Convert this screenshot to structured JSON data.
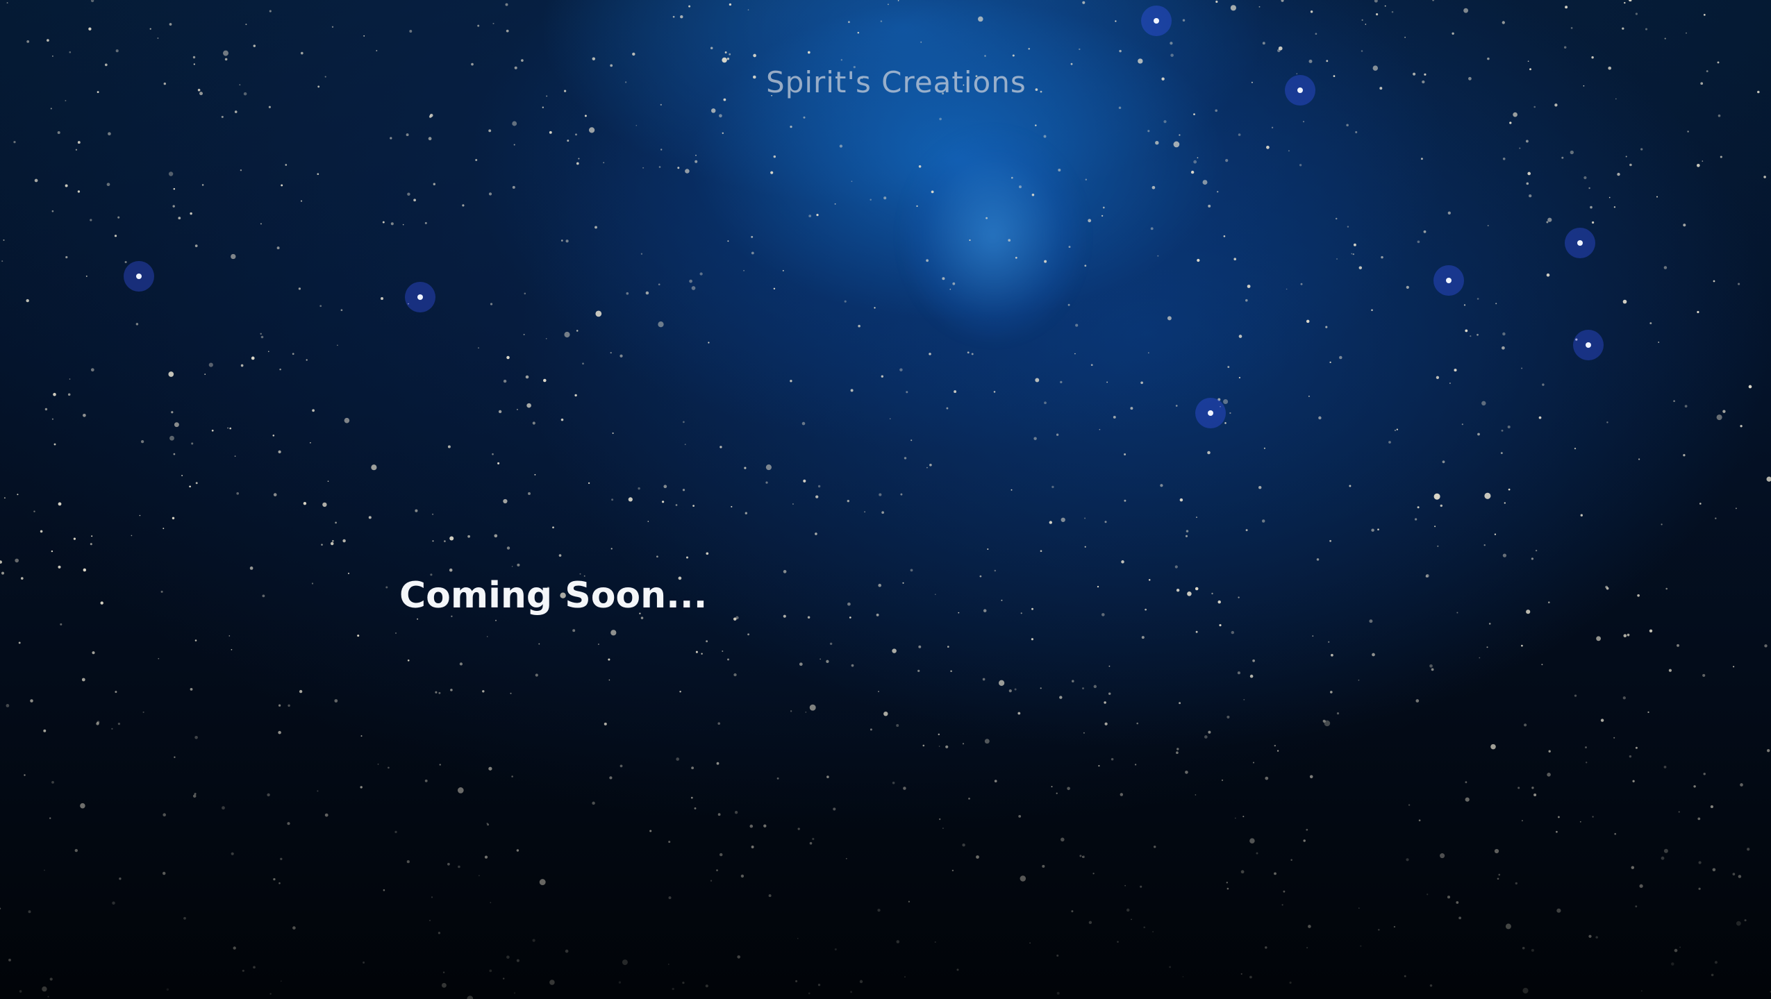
{
  "site": {
    "title": "Spirit's Creations"
  },
  "main": {
    "message": "Coming Soon..."
  },
  "background": {
    "description_icon": "starfield-nebula-background",
    "colors": {
      "deep": "#02060d",
      "nebula": "#1468c8",
      "star": "#e8e2d0",
      "text": "#f4f6f9"
    }
  }
}
